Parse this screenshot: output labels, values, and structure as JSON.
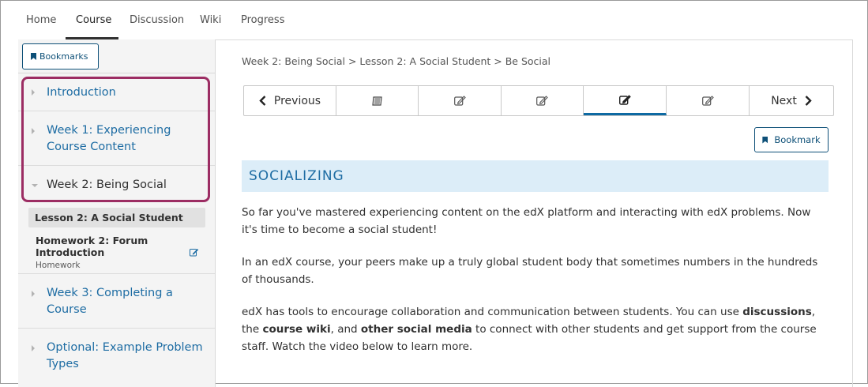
{
  "nav": {
    "tabs": [
      {
        "label": "Home"
      },
      {
        "label": "Course"
      },
      {
        "label": "Discussion"
      },
      {
        "label": "Wiki"
      },
      {
        "label": "Progress"
      }
    ],
    "active_tab": "Course"
  },
  "sidebar": {
    "bookmarks_label": "Bookmarks",
    "sections": [
      {
        "label": "Introduction",
        "expanded": false
      },
      {
        "label": "Week 1: Experiencing Course Content",
        "expanded": false
      },
      {
        "label": "Week 2: Being Social",
        "expanded": true
      },
      {
        "label": "Week 3: Completing a Course",
        "expanded": false
      },
      {
        "label": "Optional: Example Problem Types",
        "expanded": false
      }
    ],
    "subsections": [
      {
        "title": "Lesson 2: A Social Student",
        "active": true
      },
      {
        "title": "Homework 2: Forum Introduction",
        "subtitle": "Homework",
        "icon": "edit-icon"
      }
    ]
  },
  "content": {
    "breadcrumb": "Week 2: Being Social > Lesson 2: A Social Student > Be Social",
    "sequence": {
      "previous_label": "Previous",
      "next_label": "Next",
      "units": [
        {
          "icon": "book-icon",
          "active": false
        },
        {
          "icon": "edit-icon",
          "active": false
        },
        {
          "icon": "edit-icon",
          "active": false
        },
        {
          "icon": "edit-icon",
          "active": true
        },
        {
          "icon": "edit-icon",
          "active": false
        }
      ]
    },
    "bookmark_label": "Bookmark",
    "unit_title": "SOCIALIZING",
    "paragraphs": {
      "p1": "So far you've mastered experiencing content on the edX platform and interacting with edX problems. Now it's time to become a social student!",
      "p2": "In an edX course, your peers make up a truly global student body that sometimes numbers in the hundreds of thousands.",
      "p3_a": "edX has tools to encourage collaboration and communication between students. You can use ",
      "p3_b": "discussions",
      "p3_c": ", the ",
      "p3_d": "course wiki",
      "p3_e": ", and ",
      "p3_f": "other social media",
      "p3_g": " to connect with other students and get support from the course staff. Watch the video below to learn more."
    }
  },
  "colors": {
    "link_blue": "#1d6ca3",
    "highlight": "#9c2d63",
    "header_bg": "#dcedf8"
  }
}
